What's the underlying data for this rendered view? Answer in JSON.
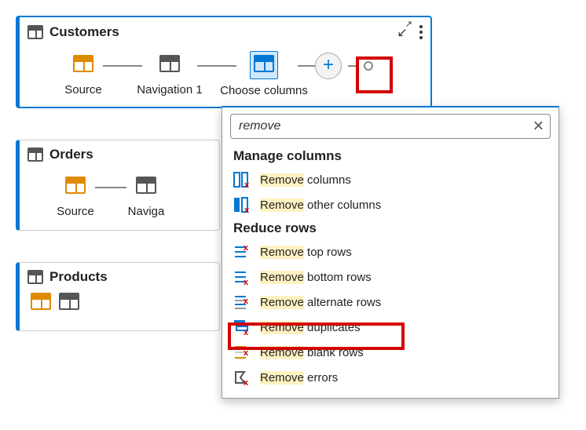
{
  "cards": {
    "customers": {
      "title": "Customers"
    },
    "orders": {
      "title": "Orders"
    },
    "products": {
      "title": "Products"
    }
  },
  "steps": {
    "source": "Source",
    "navigation1": "Navigation 1",
    "choose_columns": "Choose columns",
    "navigation_short": "Naviga"
  },
  "search": {
    "value": "remove"
  },
  "sections": {
    "manage_columns": "Manage columns",
    "reduce_rows": "Reduce rows"
  },
  "items": {
    "remove_columns": {
      "hl": "Remove",
      "rest": " columns"
    },
    "remove_other_columns": {
      "hl": "Remove",
      "rest": " other columns"
    },
    "remove_top_rows": {
      "hl": "Remove",
      "rest": " top rows"
    },
    "remove_bottom_rows": {
      "hl": "Remove",
      "rest": " bottom rows"
    },
    "remove_alternate_rows": {
      "hl": "Remove",
      "rest": " alternate rows"
    },
    "remove_duplicates": {
      "hl": "Remove",
      "rest": " duplicates"
    },
    "remove_blank_rows": {
      "hl": "Remove",
      "rest": " blank rows"
    },
    "remove_errors": {
      "hl": "Remove",
      "rest": " errors"
    }
  }
}
